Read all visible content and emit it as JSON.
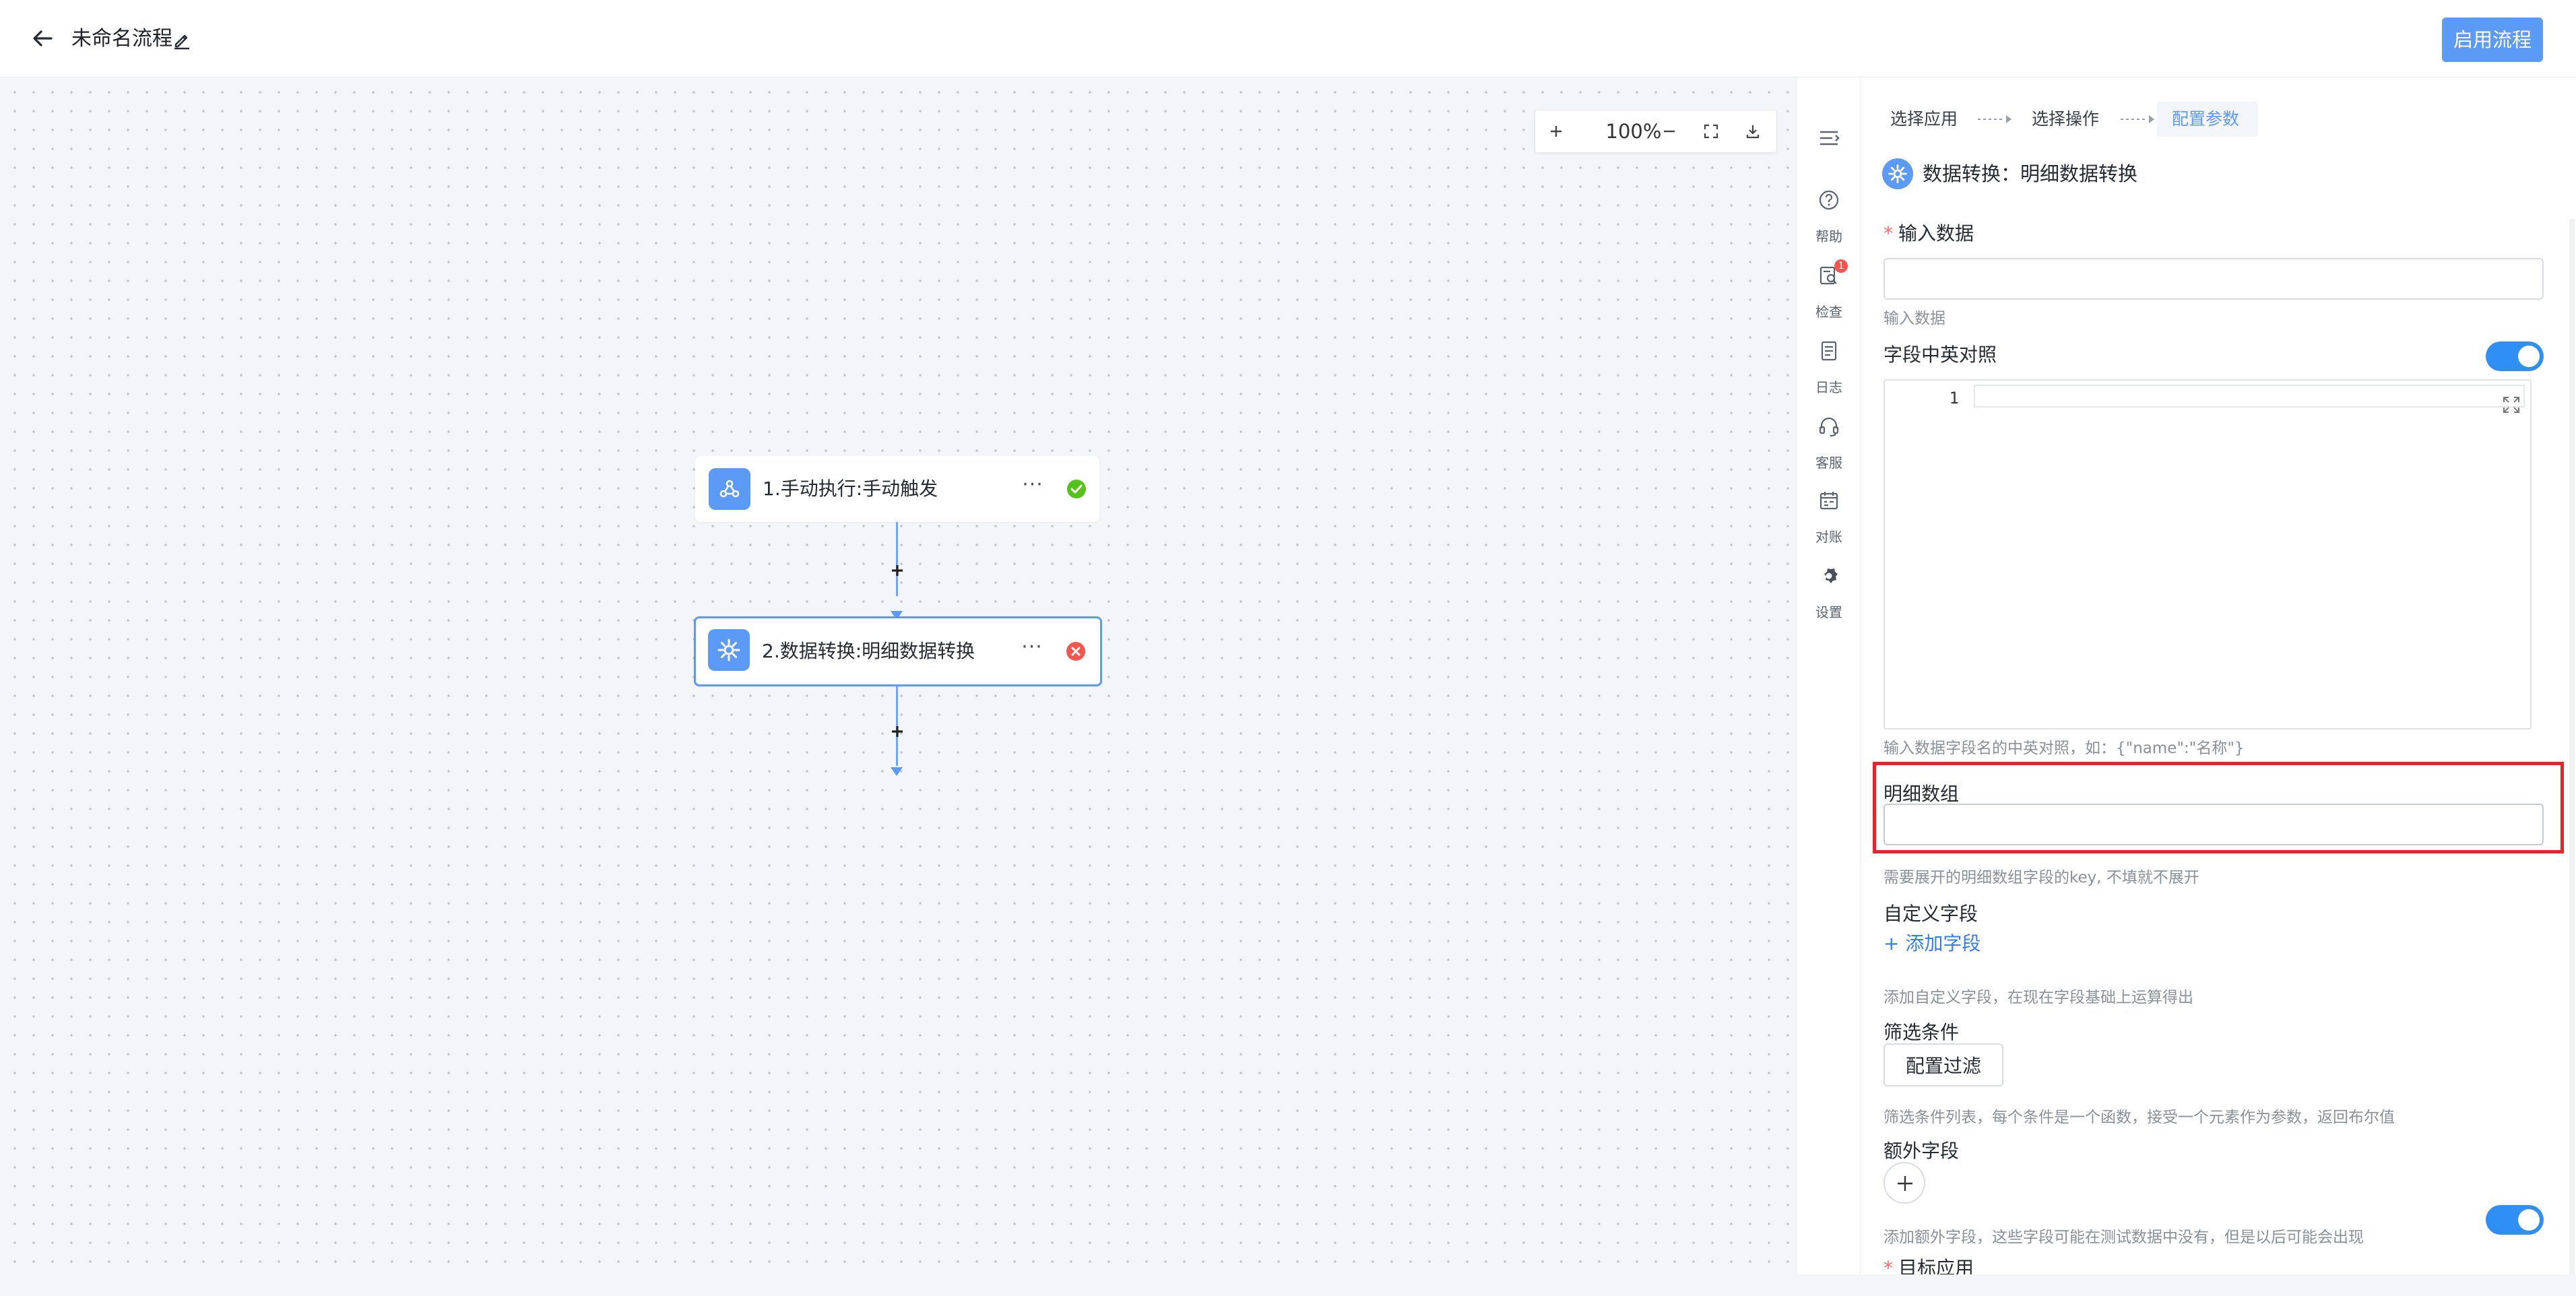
{
  "header": {
    "title": "未命名流程",
    "enable_button": "启用流程"
  },
  "canvas": {
    "zoom_level": "100%",
    "nodes": [
      {
        "label": "1.手动执行:手动触发",
        "more": "···",
        "status": "success"
      },
      {
        "label": "2.数据转换:明细数据转换",
        "more": "···",
        "status": "error"
      }
    ]
  },
  "tools": {
    "help": "帮助",
    "check": "检查",
    "check_badge": "1",
    "log": "日志",
    "service": "客服",
    "reconcile": "对账",
    "settings": "设置"
  },
  "panel": {
    "steps": [
      "选择应用",
      "选择操作",
      "配置参数"
    ],
    "node_title": "数据转换：明细数据转换",
    "input_data": {
      "label": "输入数据",
      "required_mark": "*",
      "hint": "输入数据",
      "value": ""
    },
    "field_mapping": {
      "label": "字段中英对照",
      "enabled": true,
      "line_number": "1",
      "hint": "输入数据字段名的中英对照，如：{\"name\":\"名称\"}"
    },
    "detail_array": {
      "label": "明细数组",
      "value": "",
      "hint": "需要展开的明细数组字段的key, 不填就不展开"
    },
    "custom_fields": {
      "label": "自定义字段",
      "add_label": "+ 添加字段",
      "hint": "添加自定义字段，在现在字段基础上运算得出"
    },
    "filter": {
      "label": "筛选条件",
      "button": "配置过滤",
      "hint": "筛选条件列表，每个条件是一个函数，接受一个元素作为参数，返回布尔值"
    },
    "extra_fields": {
      "label": "额外字段",
      "enabled": true,
      "hint": "添加额外字段，这些字段可能在测试数据中没有，但是以后可能会出现"
    },
    "target_app": {
      "label": "目标应用",
      "required_mark": "*"
    }
  },
  "colors": {
    "primary": "#5b9af5",
    "link": "#2f7ff0",
    "success": "#52c41a",
    "error": "#f5574f",
    "highlight": "#e8232a"
  }
}
